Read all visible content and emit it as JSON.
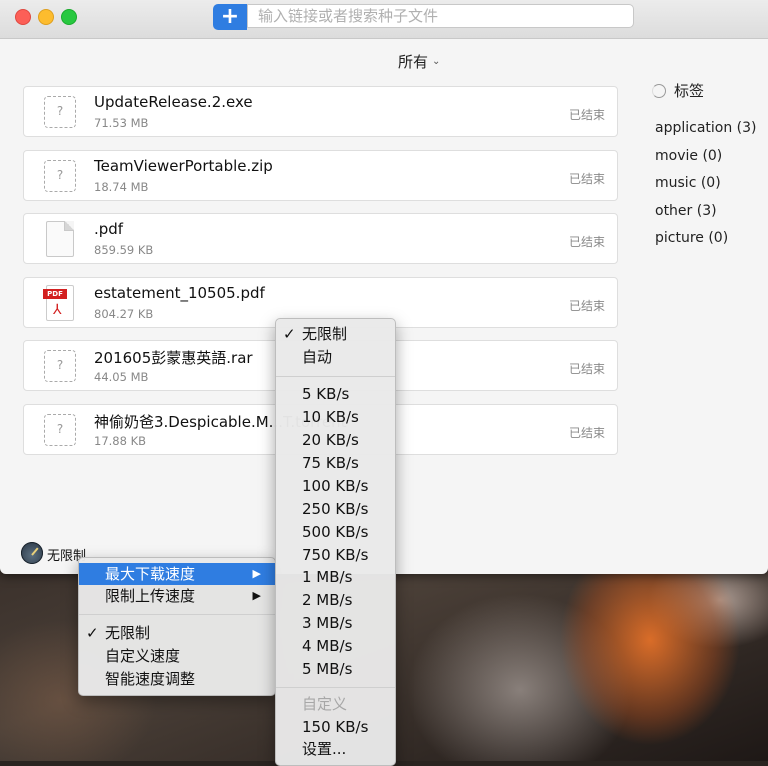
{
  "search": {
    "placeholder": "输入链接或者搜索种子文件",
    "add_label": "+"
  },
  "filter": {
    "label": "所有",
    "chevron": "⌄"
  },
  "files": [
    {
      "name": "UpdateRelease.2.exe",
      "size": "71.53 MB",
      "status": "已结束",
      "icon": "unknown"
    },
    {
      "name": "TeamViewerPortable.zip",
      "size": "18.74 MB",
      "status": "已结束",
      "icon": "unknown"
    },
    {
      "name": ".pdf",
      "size": "859.59 KB",
      "status": "已结束",
      "icon": "document"
    },
    {
      "name": "estatement_10505.pdf",
      "size": "804.27 KB",
      "status": "已结束",
      "icon": "pdf"
    },
    {
      "name": "201605彭蒙惠英語.rar",
      "size": "44.05 MB",
      "status": "已结束",
      "icon": "unknown"
    },
    {
      "name": "神偷奶爸3.Despicable.M...T.torrent",
      "size": "17.88 KB",
      "status": "已结束",
      "icon": "unknown"
    }
  ],
  "icon_glyph": "?",
  "pdf_badge": "PDF",
  "tags": {
    "header": "标签",
    "items": [
      "application (3)",
      "movie (0)",
      "music (0)",
      "other (3)",
      "picture (0)"
    ]
  },
  "statusbar": {
    "speed_label": "无限制"
  },
  "context_menu": {
    "items": [
      {
        "label": "最大下载速度",
        "submenu": true,
        "highlighted": true
      },
      {
        "label": "限制上传速度",
        "submenu": true
      },
      {
        "label": "无限制",
        "checked": true
      },
      {
        "label": "自定义速度"
      },
      {
        "label": "智能速度调整"
      }
    ],
    "arrow": "▶",
    "check": "✓"
  },
  "speed_menu": {
    "unlimited": "无限制",
    "auto": "自动",
    "speeds": [
      "5 KB/s",
      "10 KB/s",
      "20 KB/s",
      "75 KB/s",
      "100 KB/s",
      "250 KB/s",
      "500 KB/s",
      "750 KB/s",
      "1 MB/s",
      "2 MB/s",
      "3 MB/s",
      "4 MB/s",
      "5 MB/s"
    ],
    "custom_header": "自定义",
    "custom_value": "150 KB/s",
    "settings": "设置...",
    "check": "✓"
  },
  "colors": {
    "accent": "#2f7de1",
    "pdf_red": "#d32020"
  }
}
